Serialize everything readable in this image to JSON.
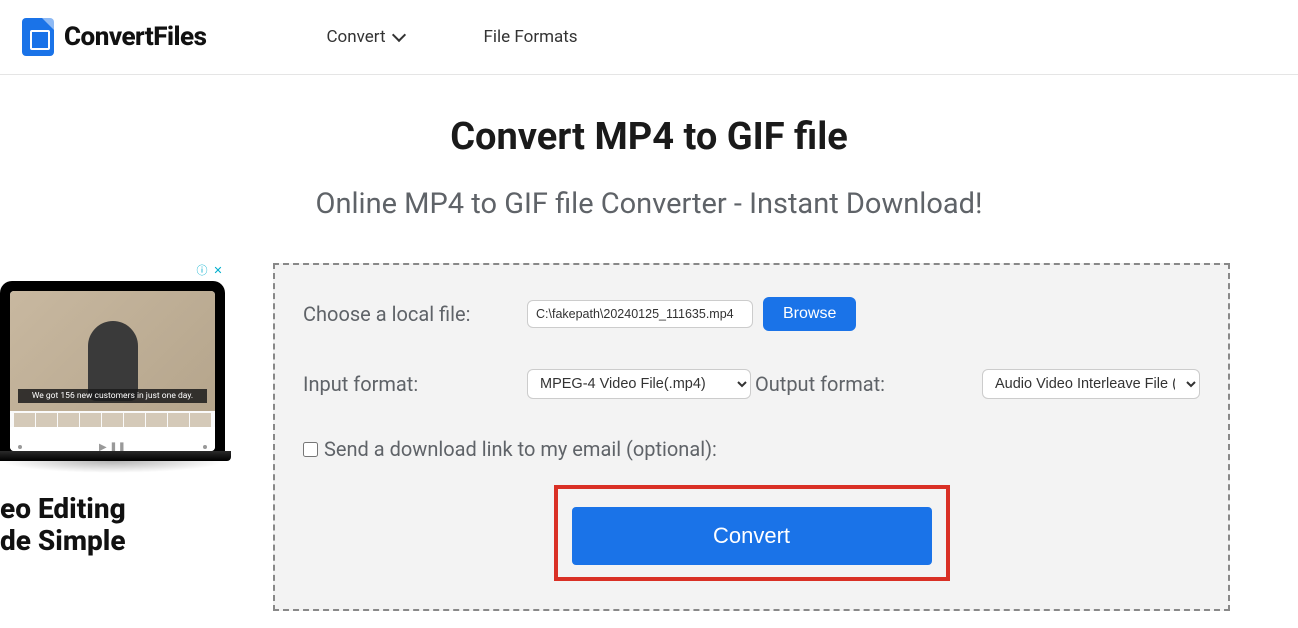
{
  "header": {
    "brand": "ConvertFiles",
    "nav": {
      "convert": "Convert",
      "formats": "File Formats"
    }
  },
  "page": {
    "title": "Convert MP4 to GIF file",
    "subtitle": "Online MP4 to GIF file Converter - Instant Download!"
  },
  "form": {
    "choose_label": "Choose a local file:",
    "file_value": "C:\\fakepath\\20240125_111635.mp4",
    "browse_label": "Browse",
    "input_format_label": "Input format:",
    "input_format_value": "MPEG-4 Video File(.mp4)",
    "output_format_label": "Output format:",
    "output_format_value": "Audio Video Interleave File (",
    "email_checkbox_label": "Send a download link to my email (optional):",
    "convert_label": "Convert"
  },
  "ad": {
    "caption": "We got 156 new customers in just one day.",
    "headline_line1": "eo Editing",
    "headline_line2": "de Simple",
    "info_symbol": "ⓘ",
    "close_symbol": "✕"
  }
}
